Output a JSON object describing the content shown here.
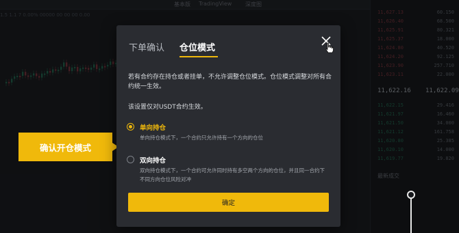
{
  "background": {
    "toolbar_tabs": [
      "基本版",
      "TradingView",
      "深度图"
    ],
    "info_line": "1.5  1.1 7 0.00% 00000  00  00  00  0.00",
    "orderbook": {
      "asks": [
        {
          "price": "11,627.13",
          "qty": "60.150"
        },
        {
          "price": "11,626.40",
          "qty": "68.500"
        },
        {
          "price": "11,625.91",
          "qty": "80.321"
        },
        {
          "price": "11,625.37",
          "qty": "18.000"
        },
        {
          "price": "11,624.80",
          "qty": "40.520"
        },
        {
          "price": "11,624.20",
          "qty": "92.125"
        },
        {
          "price": "11,623.90",
          "qty": "257.710"
        },
        {
          "price": "11,623.11",
          "qty": "22.000"
        }
      ],
      "mid_price": "11,622.16",
      "mid_price_2": "11,622.09",
      "bids": [
        {
          "price": "11,622.15",
          "qty": "29.416"
        },
        {
          "price": "11,621.97",
          "qty": "16.460"
        },
        {
          "price": "11,621.50",
          "qty": "34.000"
        },
        {
          "price": "11,621.12",
          "qty": "161.758"
        },
        {
          "price": "11,620.80",
          "qty": "25.385"
        },
        {
          "price": "11,620.10",
          "qty": "14.000"
        },
        {
          "price": "11,619.77",
          "qty": "19.820"
        }
      ],
      "recent_trades_title": "最新成交"
    }
  },
  "modal": {
    "tabs": [
      {
        "label": "下单确认",
        "active": false
      },
      {
        "label": "仓位模式",
        "active": true
      }
    ],
    "close_icon": "close-icon",
    "description": "若有合约存在持仓或者挂单，不允许调整仓位模式。仓位模式调整对所有合约统一生效。",
    "sub_note": "该设置仅对USDT合约生效。",
    "options": [
      {
        "title": "单向持仓",
        "desc": "单向持仓模式下，一个合约只允许持有一个方向的仓位",
        "checked": true,
        "title_color": "#f0b90b"
      },
      {
        "title": "双向持仓",
        "desc": "双向持仓模式下，一个合约可允许同时持有多空两个方向的仓位，并且同一合约下不同方向仓位风险对冲",
        "checked": false,
        "title_color": "#ffffff"
      }
    ],
    "confirm_label": "确定"
  },
  "callout": {
    "label": "确认开仓模式"
  },
  "colors": {
    "accent": "#f0b90b",
    "modal_bg": "#2a2c31"
  }
}
